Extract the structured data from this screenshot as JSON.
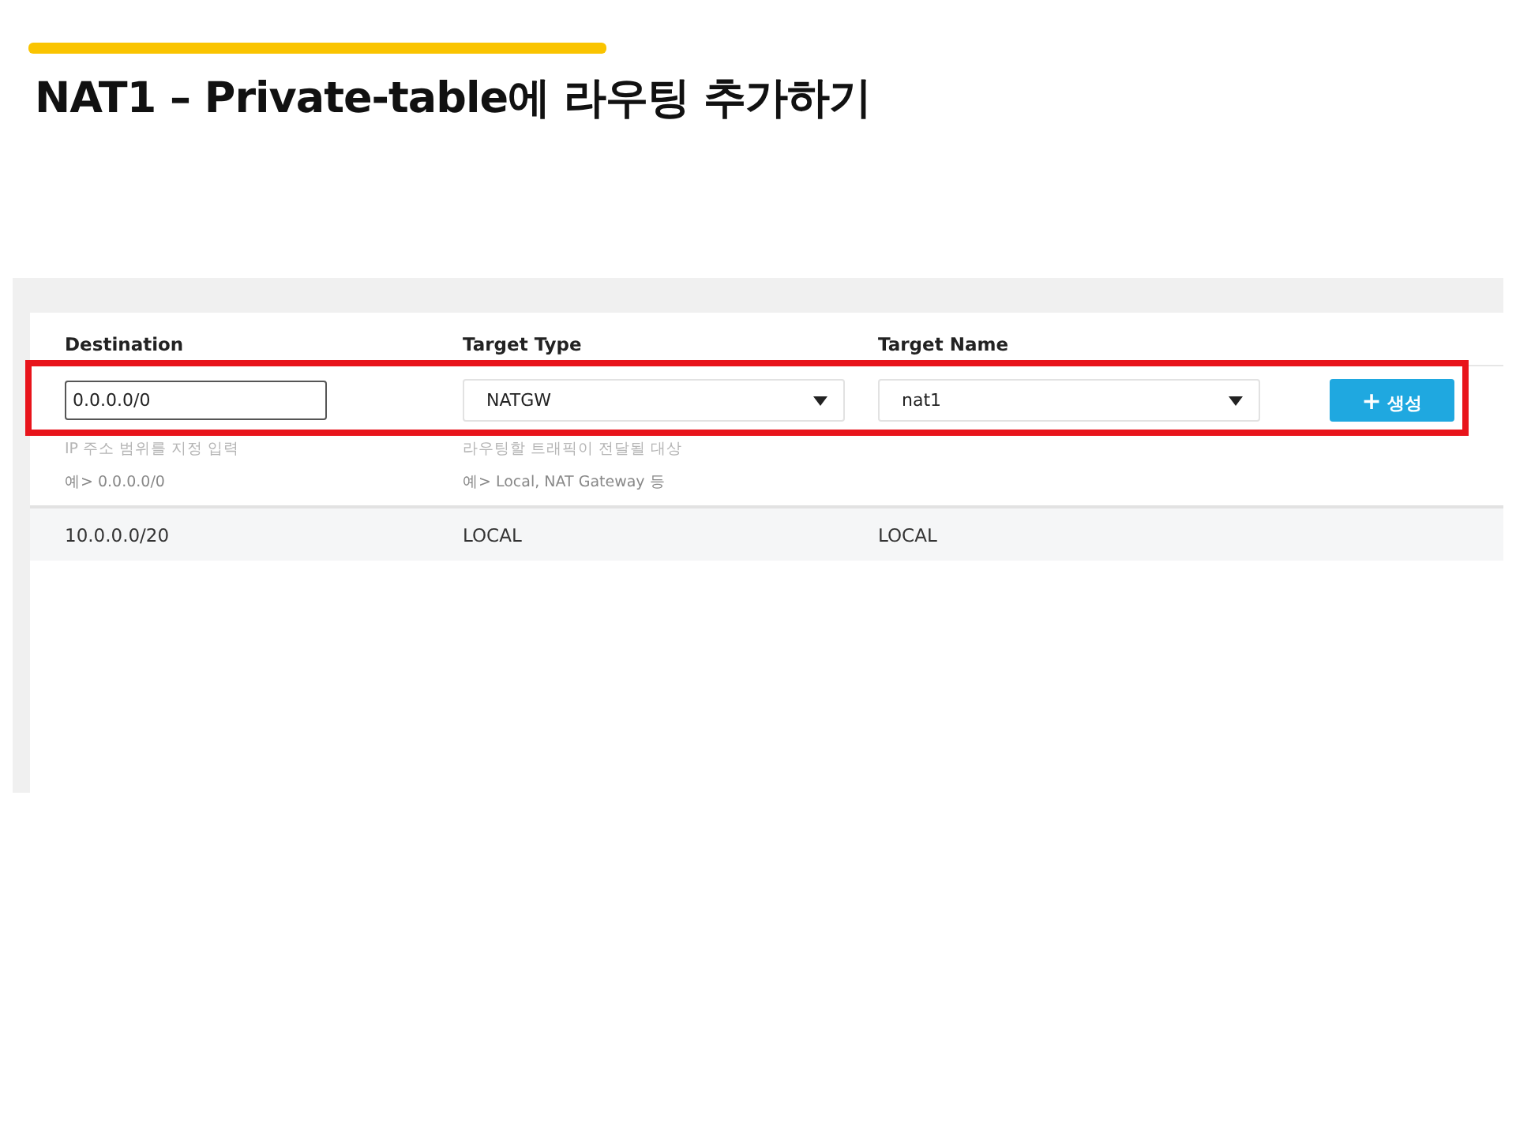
{
  "slide": {
    "title": "NAT1 – Private-table에 라우팅 추가하기"
  },
  "form": {
    "columns": [
      "Destination",
      "Target Type",
      "Target Name"
    ],
    "destination": {
      "value": "0.0.0.0/0",
      "hint": "IP 주소 범위를 지정 입력",
      "example": "예> 0.0.0.0/0"
    },
    "target_type": {
      "value": "NATGW",
      "hint": "라우팅할 트래픽이 전달될 대상",
      "example": "예> Local, NAT Gateway 등"
    },
    "target_name": {
      "value": "nat1"
    },
    "create_button": {
      "icon": "+",
      "label": "생성"
    },
    "highlighted": true
  },
  "routes": [
    {
      "destination": "10.0.0.0/20",
      "target_type": "LOCAL",
      "target_name": "LOCAL"
    }
  ]
}
